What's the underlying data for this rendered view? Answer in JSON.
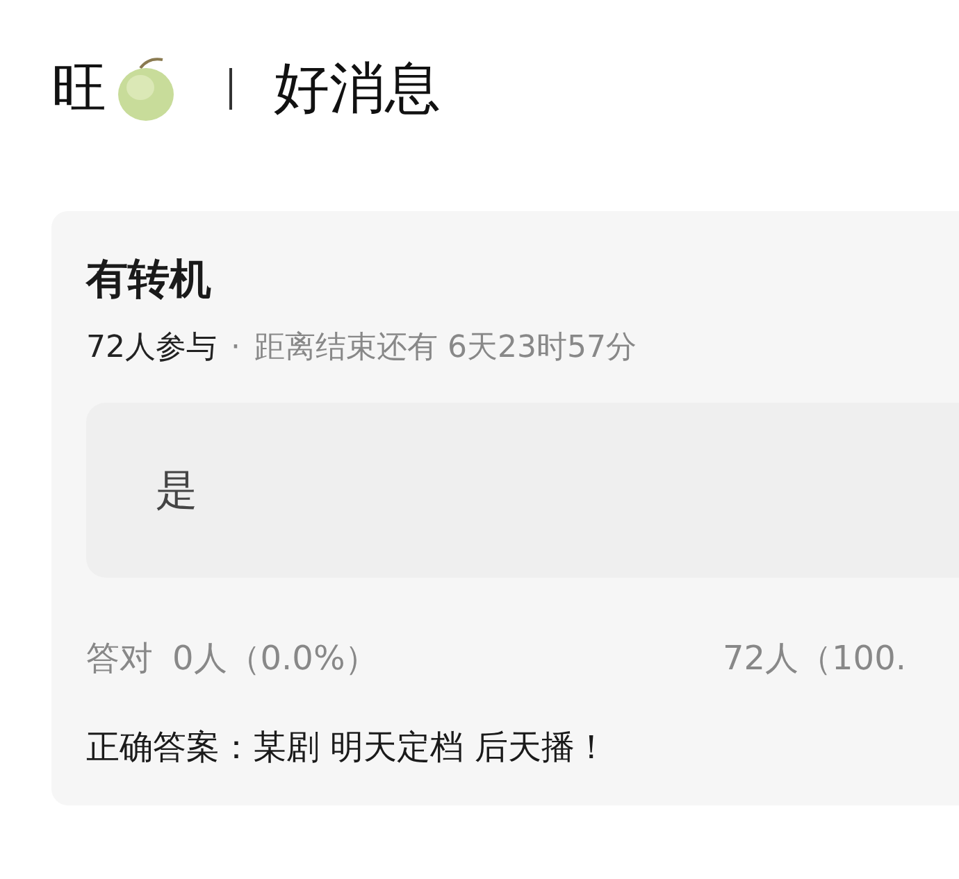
{
  "header": {
    "name": "旺",
    "title": "好消息"
  },
  "poll": {
    "title": "有转机",
    "participants": "72人参与",
    "separator": "·",
    "countdown": "距离结束还有 6天23时57分",
    "options": [
      {
        "label": "是"
      }
    ],
    "stats": {
      "label": "答对",
      "correct": "0人（0.0%）",
      "other": "72人（100."
    },
    "answer": "正确答案：某剧 明天定档 后天播！"
  }
}
